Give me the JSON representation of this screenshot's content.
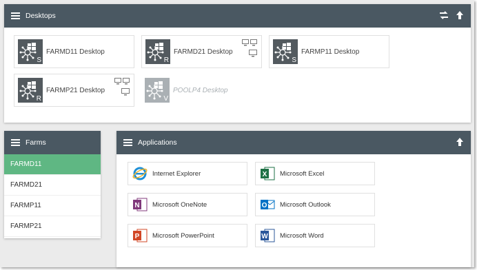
{
  "desktops": {
    "title": "Desktops",
    "items": [
      {
        "label": "FARMD11 Desktop",
        "letter": "S",
        "enabled": true,
        "multi_monitor": false
      },
      {
        "label": "FARMD21 Desktop",
        "letter": "R",
        "enabled": true,
        "multi_monitor": true
      },
      {
        "label": "FARMP11 Desktop",
        "letter": "S",
        "enabled": true,
        "multi_monitor": false
      },
      {
        "label": "FARMP21 Desktop",
        "letter": "R",
        "enabled": true,
        "multi_monitor": true
      },
      {
        "label": "POOLP4 Desktop",
        "letter": "V",
        "enabled": false,
        "multi_monitor": false
      }
    ]
  },
  "farms": {
    "title": "Farms",
    "items": [
      {
        "label": "FARMD11",
        "active": true
      },
      {
        "label": "FARMD21",
        "active": false
      },
      {
        "label": "FARMP11",
        "active": false
      },
      {
        "label": "FARMP21",
        "active": false
      }
    ]
  },
  "applications": {
    "title": "Applications",
    "items": [
      {
        "label": "Internet Explorer",
        "icon": "internet-explorer-icon"
      },
      {
        "label": "Microsoft Excel",
        "icon": "excel-icon"
      },
      {
        "label": "Microsoft OneNote",
        "icon": "onenote-icon"
      },
      {
        "label": "Microsoft Outlook",
        "icon": "outlook-icon"
      },
      {
        "label": "Microsoft PowerPoint",
        "icon": "powerpoint-icon"
      },
      {
        "label": "Microsoft Word",
        "icon": "word-icon"
      }
    ]
  },
  "colors": {
    "header": "#4a5862",
    "active_farm": "#5fb783",
    "desktop_icon": "#535a5f"
  }
}
